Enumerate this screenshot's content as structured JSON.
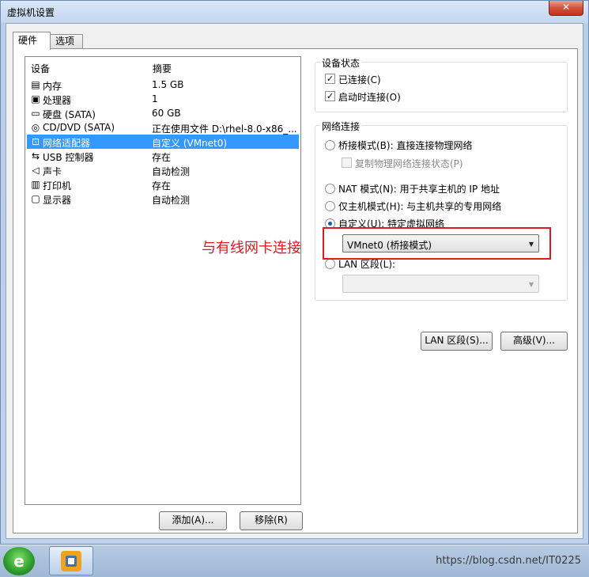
{
  "window": {
    "title": "虚拟机设置",
    "close_label": "✕"
  },
  "tabs": [
    {
      "label": "硬件",
      "active": true
    },
    {
      "label": "选项",
      "active": false
    }
  ],
  "device_list": {
    "header_device": "设备",
    "header_summary": "摘要",
    "rows": [
      {
        "icon": "memory-icon",
        "glyph": "▤",
        "name": "内存",
        "summary": "1.5 GB"
      },
      {
        "icon": "cpu-icon",
        "glyph": "▣",
        "name": "处理器",
        "summary": "1"
      },
      {
        "icon": "harddisk-icon",
        "glyph": "▭",
        "name": "硬盘 (SATA)",
        "summary": "60 GB"
      },
      {
        "icon": "cd-icon",
        "glyph": "◎",
        "name": "CD/DVD (SATA)",
        "summary": "正在使用文件 D:\\rhel-8.0-x86_..."
      },
      {
        "icon": "network-adapter-icon",
        "glyph": "⊡",
        "name": "网络适配器",
        "summary": "自定义 (VMnet0)",
        "selected": true
      },
      {
        "icon": "usb-icon",
        "glyph": "⇆",
        "name": "USB 控制器",
        "summary": "存在"
      },
      {
        "icon": "speaker-icon",
        "glyph": "◁",
        "name": "声卡",
        "summary": "自动检测"
      },
      {
        "icon": "printer-icon",
        "glyph": "▥",
        "name": "打印机",
        "summary": "存在"
      },
      {
        "icon": "monitor-icon",
        "glyph": "▢",
        "name": "显示器",
        "summary": "自动检测"
      }
    ],
    "add_button": "添加(A)...",
    "remove_button": "移除(R)"
  },
  "device_status": {
    "title": "设备状态",
    "connected": {
      "label": "已连接(C)",
      "checked": true
    },
    "connect_at_power_on": {
      "label": "启动时连接(O)",
      "checked": true
    }
  },
  "network": {
    "title": "网络连接",
    "bridged": {
      "label": "桥接模式(B): 直接连接物理网络",
      "selected": false
    },
    "replicate": {
      "label": "复制物理网络连接状态(P)",
      "checked": false
    },
    "nat": {
      "label": "NAT 模式(N): 用于共享主机的 IP 地址",
      "selected": false
    },
    "host_only": {
      "label": "仅主机模式(H): 与主机共享的专用网络",
      "selected": false
    },
    "custom": {
      "label": "自定义(U): 特定虚拟网络",
      "selected": true,
      "value": "VMnet0 (桥接模式)"
    },
    "lan_segment": {
      "label": "LAN 区段(L):",
      "selected": false,
      "value": ""
    },
    "lan_segments_button": "LAN 区段(S)...",
    "advanced_button": "高级(V)..."
  },
  "annotation": {
    "text": "与有线网卡连接",
    "color": "#e0191e"
  },
  "taskbar": {
    "start_glyph": "e",
    "watermark": "https://blog.csdn.net/IT0225"
  },
  "colors": {
    "selection": "#3399ff",
    "accent": "#1e5aa8"
  }
}
